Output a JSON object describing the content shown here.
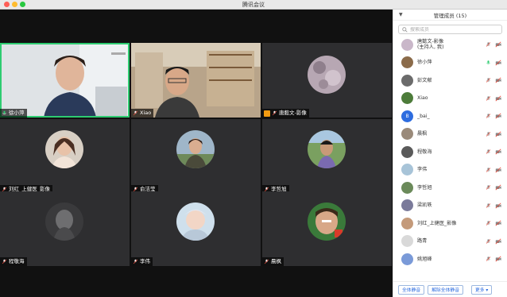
{
  "window": {
    "title": "腾讯会议"
  },
  "grid": {
    "tiles": [
      {
        "name": "徐小萍"
      },
      {
        "name": "Xiao"
      },
      {
        "name": "唐懿文-影像"
      },
      {
        "name": "刘红_上健医_影像"
      },
      {
        "name": "俞洁莹"
      },
      {
        "name": "李哲旭"
      },
      {
        "name": "程敬海"
      },
      {
        "name": "李伟"
      },
      {
        "name": "晨枫"
      }
    ]
  },
  "panel": {
    "title": "管理成员 (15)",
    "search_placeholder": "搜索成员",
    "members": [
      {
        "name": "唐懿文-影像",
        "sub": "(主持人, 我)",
        "avatar": "#c9b7c9",
        "mic_active": false
      },
      {
        "name": "徐小萍",
        "sub": "",
        "avatar": "#8b6b4a",
        "mic_active": true
      },
      {
        "name": "彭文献",
        "sub": "",
        "avatar": "#6b6b6b",
        "mic_active": false
      },
      {
        "name": "Xiao",
        "sub": "",
        "avatar": "#4d7c3a",
        "mic_active": false
      },
      {
        "name": "_bai_",
        "sub": "",
        "avatar": "#2d6cdf",
        "avatar_text": "B",
        "mic_active": false
      },
      {
        "name": "晨枫",
        "sub": "",
        "avatar": "#9a8a7a",
        "mic_active": false
      },
      {
        "name": "程敬海",
        "sub": "",
        "avatar": "#5a5a5a",
        "mic_active": false
      },
      {
        "name": "李伟",
        "sub": "",
        "avatar": "#a8c4d8",
        "mic_active": false
      },
      {
        "name": "李哲旭",
        "sub": "",
        "avatar": "#6b8a5a",
        "mic_active": false
      },
      {
        "name": "梁凯轶",
        "sub": "",
        "avatar": "#7a7a9a",
        "mic_active": false
      },
      {
        "name": "刘红_上健医_影像",
        "sub": "",
        "avatar": "#c49a7a",
        "mic_active": false
      },
      {
        "name": "路青",
        "sub": "",
        "avatar": "#d9d9d9",
        "mic_active": false
      },
      {
        "name": "姚旭峰",
        "sub": "",
        "avatar": "#7a9ad8",
        "mic_active": false
      }
    ],
    "footer": {
      "mute_all": "全体静音",
      "unmute_all": "解除全体静音",
      "more": "更多 ▾"
    }
  },
  "colors": {
    "active_speaker": "#2ecc71",
    "accent": "#2d6cdf",
    "mic_green": "#2ecc71",
    "video_off": "#e74c3c"
  }
}
